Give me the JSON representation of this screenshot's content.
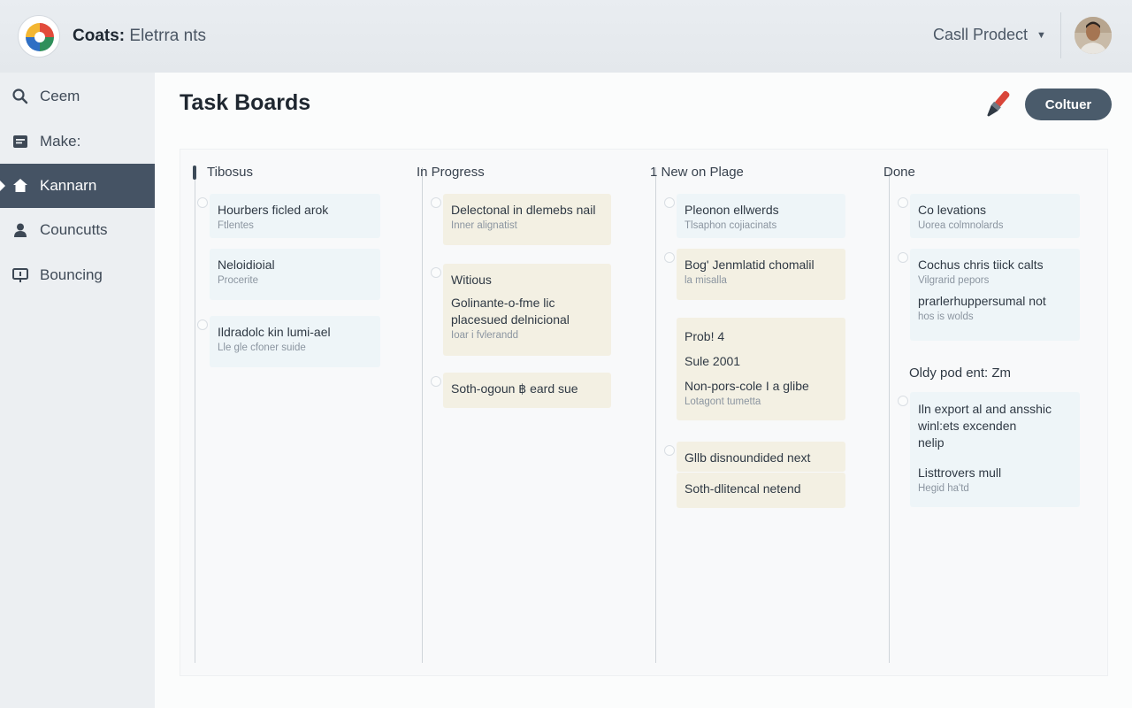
{
  "header": {
    "app_name": "Coats:",
    "app_subtitle": " Eletrra nts",
    "project": "Casll Prodect"
  },
  "sidebar": {
    "items": [
      {
        "label": "Ceem",
        "icon": "search-icon"
      },
      {
        "label": "Make:",
        "icon": "document-icon"
      },
      {
        "label": "Kannarn",
        "icon": "home-icon",
        "active": true
      },
      {
        "label": "Councutts",
        "icon": "user-icon"
      },
      {
        "label": "Bouncing",
        "icon": "presentation-icon"
      }
    ]
  },
  "main": {
    "title": "Task Boards",
    "primary_button": "Coltuer"
  },
  "board": {
    "columns": [
      {
        "title": "Tibosus",
        "cards": [
          {
            "lines": [
              {
                "text": "Hourbers ficled arok"
              },
              {
                "text": "Ftlentes",
                "sub": true
              }
            ]
          },
          {
            "lines": [
              {
                "text": "Neloidioial"
              },
              {
                "text": "Procerite",
                "sub": true
              }
            ]
          },
          {
            "lines": [
              {
                "text": "Ildradolc kin lumi-ael"
              },
              {
                "text": "Lle gle cfoner suide",
                "sub": true
              }
            ]
          }
        ]
      },
      {
        "title": "In Progress",
        "cards": [
          {
            "lines": [
              {
                "text": "Delectonal in dlemebs nail"
              },
              {
                "text": "Inner alignatist",
                "sub": true
              }
            ]
          },
          {
            "lines": [
              {
                "text": "Witious"
              },
              {
                "text": "Golinante-o-fme lic"
              },
              {
                "text": "placesued delnicional"
              },
              {
                "text": "Ioar i fvlerandd",
                "sub": true
              }
            ]
          },
          {
            "lines": [
              {
                "text": "Soth-ogoun ฿ eard sue"
              }
            ]
          }
        ]
      },
      {
        "title": "1 New on Plage",
        "cards": [
          {
            "lines": [
              {
                "text": "Pleonon ellwerds"
              },
              {
                "text": "Tlsaphon cojiacinats",
                "sub": true
              }
            ]
          },
          {
            "lines": [
              {
                "text": "Bog' Jenmlatid chomalil"
              },
              {
                "text": "la misalla",
                "sub": true
              }
            ]
          },
          {
            "lines": [
              {
                "text": "Prob! 4"
              },
              {
                "text": "Sule 2001"
              },
              {
                "text": "Non-pors-cole I a glibe"
              },
              {
                "text": "Lotagont tumetta",
                "sub": true
              }
            ]
          },
          {
            "lines": [
              {
                "text": "Gllb disnoundided next"
              }
            ]
          },
          {
            "lines": [
              {
                "text": "Soth-dlitencal netend"
              }
            ]
          }
        ]
      },
      {
        "title": "Done",
        "cards": [
          {
            "lines": [
              {
                "text": "Co levations"
              },
              {
                "text": "Uorea colmnolards",
                "sub": true
              }
            ]
          },
          {
            "lines": [
              {
                "text": "Cochus chris tiick calts"
              },
              {
                "text": "Vilgrarid pepors",
                "sub": true
              },
              {
                "text": "prarlerhuppersumal not"
              },
              {
                "text": "hos is wolds",
                "sub": true
              }
            ]
          },
          {
            "lines": [
              {
                "text": "Iln export al and ansshic"
              },
              {
                "text": "winl:ets excenden"
              },
              {
                "text": "nelip"
              },
              {
                "text": "Listtrovers mull"
              },
              {
                "text": "Hegid ha'td",
                "sub": true
              }
            ]
          }
        ],
        "section_label": "Oldy pod ent: Zm"
      }
    ]
  },
  "colors": {
    "active_nav": "#455364",
    "primary_button": "#4a5b6b",
    "card_blue": "#eef5f8",
    "card_beige": "#f3f0e3"
  }
}
